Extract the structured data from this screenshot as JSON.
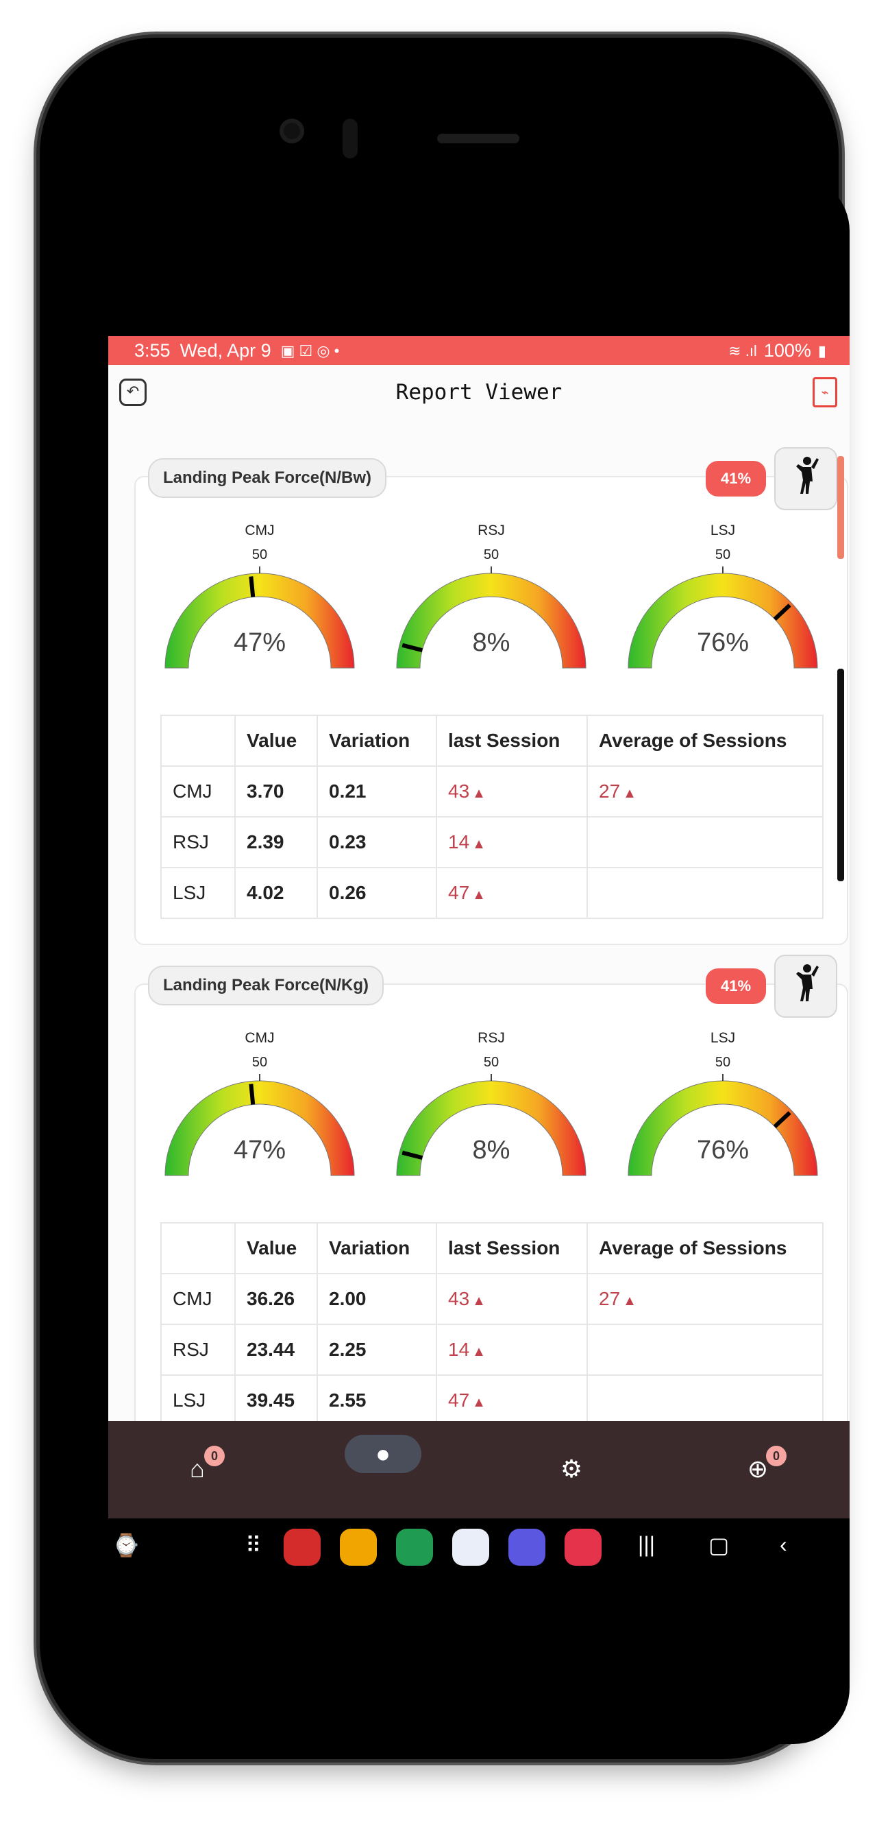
{
  "status_bar": {
    "time": "3:55",
    "date": "Wed, Apr 9",
    "battery": "100%"
  },
  "app_bar": {
    "title": "Report Viewer",
    "back_icon": "back-icon",
    "pdf_icon": "pdf-icon"
  },
  "cards": [
    {
      "label": "Landing Peak Force(N/Bw)",
      "badge": "41%",
      "gauges": [
        {
          "name": "CMJ",
          "mark": "50",
          "percent": "47%",
          "fraction": 0.47
        },
        {
          "name": "RSJ",
          "mark": "50",
          "percent": "8%",
          "fraction": 0.08
        },
        {
          "name": "LSJ",
          "mark": "50",
          "percent": "76%",
          "fraction": 0.76
        }
      ],
      "table": {
        "headers": [
          "",
          "Value",
          "Variation",
          "last Session",
          "Average of Sessions"
        ],
        "rows": [
          {
            "name": "CMJ",
            "value": "3.70",
            "variation": "0.21",
            "last": "43",
            "avg": "27"
          },
          {
            "name": "RSJ",
            "value": "2.39",
            "variation": "0.23",
            "last": "14",
            "avg": ""
          },
          {
            "name": "LSJ",
            "value": "4.02",
            "variation": "0.26",
            "last": "47",
            "avg": ""
          }
        ]
      }
    },
    {
      "label": "Landing Peak Force(N/Kg)",
      "badge": "41%",
      "gauges": [
        {
          "name": "CMJ",
          "mark": "50",
          "percent": "47%",
          "fraction": 0.47
        },
        {
          "name": "RSJ",
          "mark": "50",
          "percent": "8%",
          "fraction": 0.08
        },
        {
          "name": "LSJ",
          "mark": "50",
          "percent": "76%",
          "fraction": 0.76
        }
      ],
      "table": {
        "headers": [
          "",
          "Value",
          "Variation",
          "last Session",
          "Average of Sessions"
        ],
        "rows": [
          {
            "name": "CMJ",
            "value": "36.26",
            "variation": "2.00",
            "last": "43",
            "avg": "27"
          },
          {
            "name": "RSJ",
            "value": "23.44",
            "variation": "2.25",
            "last": "14",
            "avg": ""
          },
          {
            "name": "LSJ",
            "value": "39.45",
            "variation": "2.55",
            "last": "47",
            "avg": ""
          }
        ]
      }
    }
  ],
  "bottom_nav": {
    "home_badge": "0",
    "add_badge": "0",
    "items": [
      "home-icon",
      "profile-icon",
      "settings-icon",
      "add-icon"
    ]
  },
  "colors": {
    "accent": "#f25a57",
    "nav_bg": "#3a2a2c",
    "trend_up": "#c0404b"
  }
}
